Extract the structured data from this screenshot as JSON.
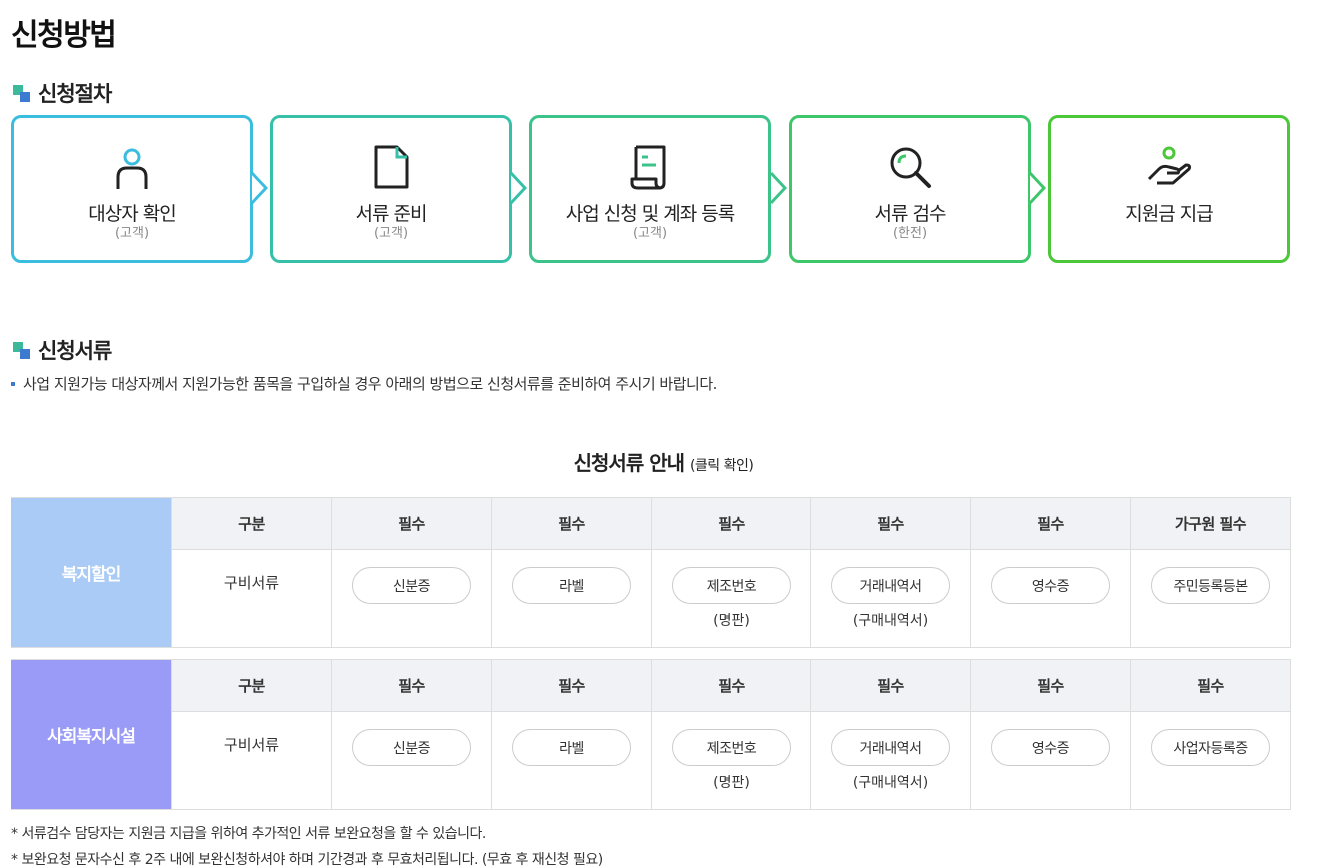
{
  "page_title": "신청방법",
  "section1": {
    "title": "신청절차"
  },
  "steps": [
    {
      "label": "대상자 확인",
      "who": "(고객)",
      "color": "#3bbde0",
      "icon": "person-icon"
    },
    {
      "label": "서류 준비",
      "who": "(고객)",
      "color": "#36c0a8",
      "icon": "document-icon"
    },
    {
      "label": "사업 신청 및 계좌 등록",
      "who": "(고객)",
      "color": "#3cc38a",
      "icon": "scroll-icon"
    },
    {
      "label": "서류 검수",
      "who": "(한전)",
      "color": "#3ec66a",
      "icon": "magnifier-icon"
    },
    {
      "label": "지원금 지급",
      "who": "",
      "color": "#4cc73a",
      "icon": "hand-coin-icon"
    }
  ],
  "section2": {
    "title": "신청서류",
    "description": "사업 지원가능 대상자께서 지원가능한 품목을 구입하실 경우 아래의 방법으로 신청서류를 준비하여 주시기 바랍니다."
  },
  "table_caption": {
    "main": "신청서류 안내",
    "sub": "(클릭 확인)"
  },
  "tables": [
    {
      "category": "복지할인",
      "category_color": "#a9cbf5",
      "headers": [
        "구분",
        "필수",
        "필수",
        "필수",
        "필수",
        "필수",
        "가구원 필수"
      ],
      "row_label": "구비서류",
      "docs": [
        {
          "name": "신분증",
          "sub": ""
        },
        {
          "name": "라벨",
          "sub": ""
        },
        {
          "name": "제조번호",
          "sub": "(명판)"
        },
        {
          "name": "거래내역서",
          "sub": "(구매내역서)"
        },
        {
          "name": "영수증",
          "sub": ""
        },
        {
          "name": "주민등록등본",
          "sub": ""
        }
      ]
    },
    {
      "category": "사회복지시설",
      "category_color": "#9a9bf7",
      "headers": [
        "구분",
        "필수",
        "필수",
        "필수",
        "필수",
        "필수",
        "필수"
      ],
      "row_label": "구비서류",
      "docs": [
        {
          "name": "신분증",
          "sub": ""
        },
        {
          "name": "라벨",
          "sub": ""
        },
        {
          "name": "제조번호",
          "sub": "(명판)"
        },
        {
          "name": "거래내역서",
          "sub": "(구매내역서)"
        },
        {
          "name": "영수증",
          "sub": ""
        },
        {
          "name": "사업자등록증",
          "sub": ""
        }
      ]
    }
  ],
  "notes": [
    "* 서류검수 담당자는 지원금 지급을 위하여 추가적인 서류 보완요청을 할 수 있습니다.",
    "* 보완요청 문자수신 후 2주 내에 보완신청하셔야 하며 기간경과 후 무효처리됩니다. (무효 후 재신청 필요)"
  ]
}
